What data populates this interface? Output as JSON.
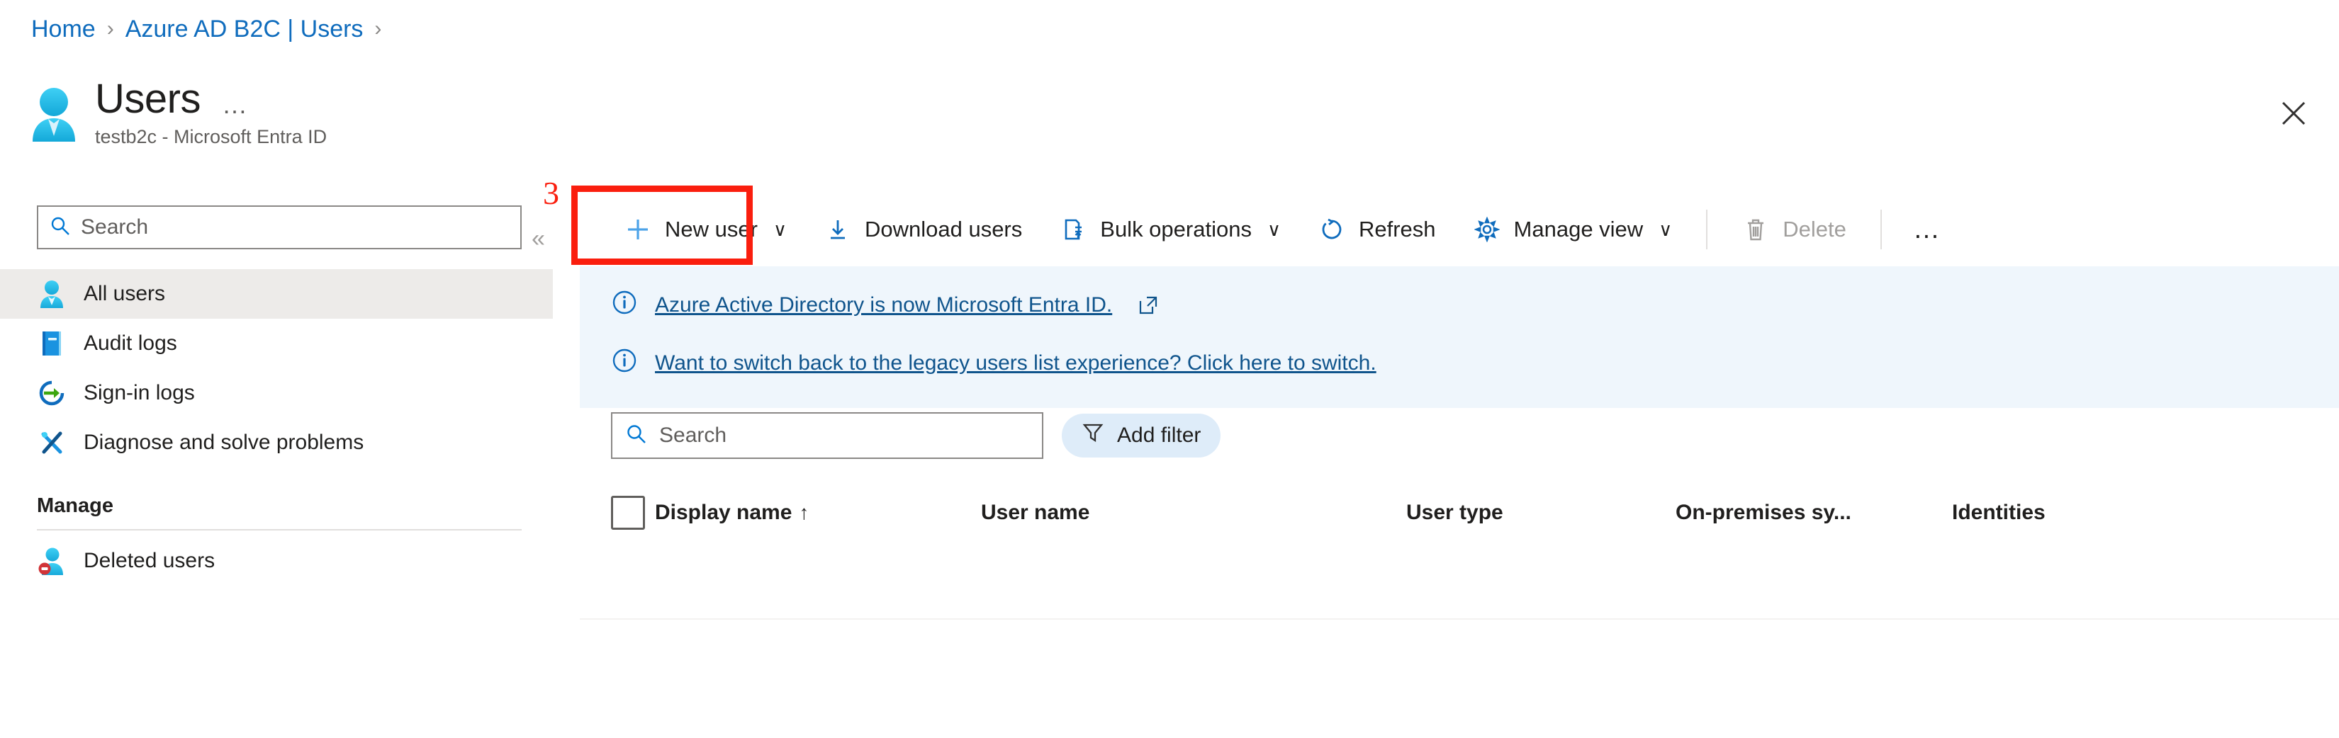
{
  "breadcrumb": {
    "items": [
      {
        "label": "Home"
      },
      {
        "label": "Azure AD B2C | Users"
      }
    ],
    "separator": "›"
  },
  "header": {
    "title": "Users",
    "subtitle": "testb2c - Microsoft Entra ID",
    "ellipsis": "…",
    "avatar_icon": "user-avatar-icon",
    "close_icon": "close-icon"
  },
  "sidebar": {
    "search": {
      "placeholder": "Search",
      "value": "",
      "icon": "search-icon"
    },
    "items": [
      {
        "label": "All users",
        "icon": "user-icon",
        "selected": true
      },
      {
        "label": "Audit logs",
        "icon": "book-icon",
        "selected": false
      },
      {
        "label": "Sign-in logs",
        "icon": "sign-in-icon",
        "selected": false
      },
      {
        "label": "Diagnose and solve problems",
        "icon": "tools-icon",
        "selected": false
      }
    ],
    "group_label": "Manage",
    "manage_items": [
      {
        "label": "Deleted users",
        "icon": "deleted-user-icon"
      }
    ],
    "collapse_chevron": "«"
  },
  "toolbar": {
    "new_user": {
      "label": "New user",
      "icon": "plus-icon",
      "chevron": "∨"
    },
    "download_users": {
      "label": "Download users",
      "icon": "download-icon"
    },
    "bulk_operations": {
      "label": "Bulk operations",
      "icon": "bulk-operations-icon",
      "chevron": "∨"
    },
    "refresh": {
      "label": "Refresh",
      "icon": "refresh-icon"
    },
    "manage_view": {
      "label": "Manage view",
      "icon": "gear-icon",
      "chevron": "∨"
    },
    "delete": {
      "label": "Delete",
      "icon": "trash-icon",
      "disabled": true
    },
    "more": "…"
  },
  "annotation": {
    "number": "3",
    "target": "New user",
    "color": "#fa1e0e"
  },
  "banners": [
    {
      "icon": "info-icon",
      "link_text": "Azure Active Directory is now Microsoft Entra ID.",
      "has_external_link": true
    },
    {
      "icon": "info-icon",
      "link_text": "Want to switch back to the legacy users list experience? Click here to switch.",
      "has_external_link": false
    }
  ],
  "filters": {
    "search": {
      "placeholder": "Search",
      "value": "",
      "icon": "search-icon"
    },
    "add_filter": {
      "label": "Add filter",
      "icon": "filter-icon"
    }
  },
  "table": {
    "select_all_checked": false,
    "columns": [
      {
        "label": "Display name",
        "sorted": true,
        "sort_arrow": "↑"
      },
      {
        "label": "User name",
        "sorted": false,
        "sort_arrow": ""
      },
      {
        "label": "User type",
        "sorted": false,
        "sort_arrow": ""
      },
      {
        "label": "On-premises sy...",
        "sorted": false,
        "sort_arrow": ""
      },
      {
        "label": "Identities",
        "sorted": false,
        "sort_arrow": ""
      }
    ],
    "rows": []
  },
  "colors": {
    "link": "#0f6cbd",
    "banner_bg": "#eff6fc",
    "banner_link": "#0f548c",
    "selected_bg": "#edebe9",
    "accent": "#0078d4",
    "annotation": "#fa1e0e"
  }
}
